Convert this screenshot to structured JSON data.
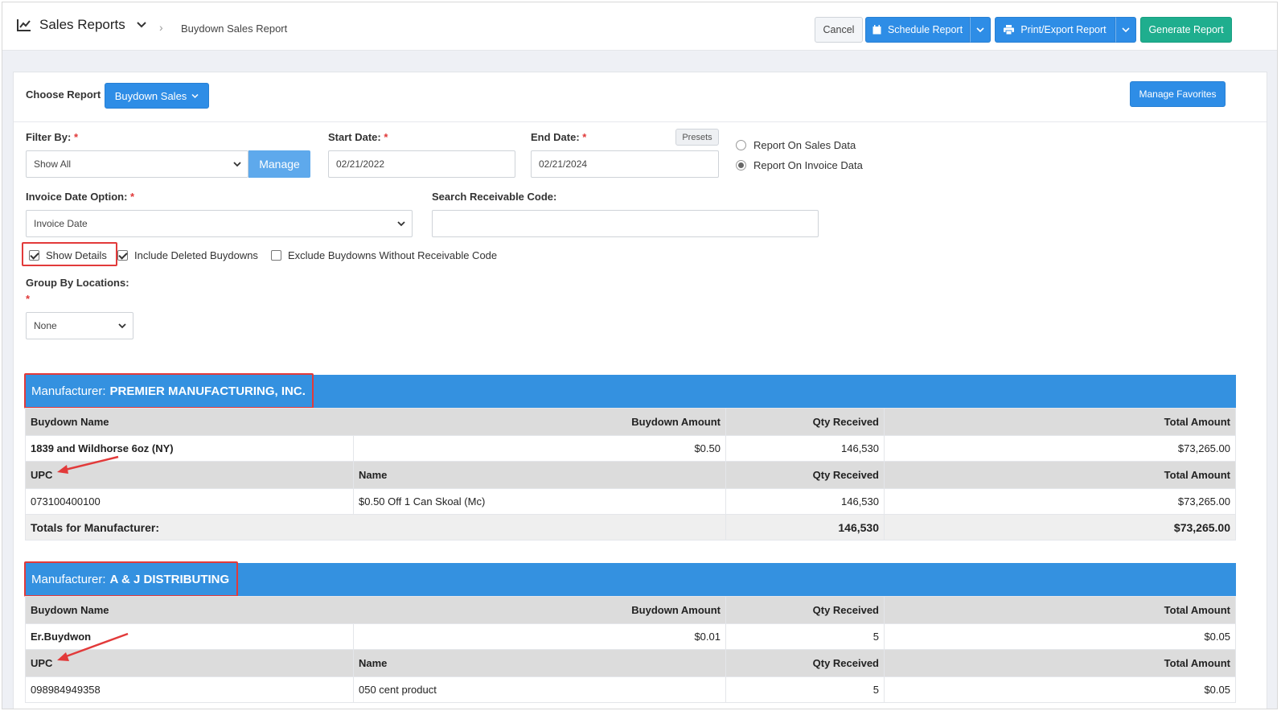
{
  "header": {
    "title": "Sales Reports",
    "breadcrumb": "Buydown Sales Report",
    "cancel": "Cancel",
    "schedule": "Schedule Report",
    "print": "Print/Export Report",
    "generate": "Generate Report"
  },
  "choose": {
    "label": "Choose Report",
    "report": "Buydown Sales",
    "manage_favorites": "Manage Favorites"
  },
  "filters": {
    "filter_by_label": "Filter By:",
    "filter_by_value": "Show All",
    "manage": "Manage",
    "start_label": "Start Date:",
    "start_value": "02/21/2022",
    "end_label": "End Date:",
    "end_value": "02/21/2024",
    "presets": "Presets",
    "radio_sales": "Report On Sales Data",
    "radio_invoice": "Report On Invoice Data",
    "invoice_date_label": "Invoice Date Option:",
    "invoice_date_value": "Invoice Date",
    "search_code_label": "Search Receivable Code:",
    "search_code_value": "",
    "show_details": "Show Details",
    "include_deleted": "Include Deleted Buydowns",
    "exclude_without_code": "Exclude Buydowns Without Receivable Code",
    "group_by_label": "Group By Locations:",
    "group_by_value": "None",
    "required_mark": "*"
  },
  "manufacturers": [
    {
      "prefix": "Manufacturer:",
      "name": "PREMIER MANUFACTURING, INC.",
      "cols": {
        "buydown_name": "Buydown Name",
        "buydown_amount": "Buydown Amount",
        "qty": "Qty Received",
        "total": "Total Amount"
      },
      "row": {
        "name": "1839 and Wildhorse 6oz (NY)",
        "amount": "$0.50",
        "qty": "146,530",
        "total": "$73,265.00"
      },
      "detail_cols": {
        "upc": "UPC",
        "name": "Name",
        "qty": "Qty Received",
        "total": "Total Amount"
      },
      "detail": {
        "upc": "073100400100",
        "name": "$0.50 Off 1 Can Skoal (Mc)",
        "qty": "146,530",
        "total": "$73,265.00"
      },
      "totals": {
        "label": "Totals for Manufacturer:",
        "qty": "146,530",
        "total": "$73,265.00"
      }
    },
    {
      "prefix": "Manufacturer:",
      "name": "A & J DISTRIBUTING",
      "cols": {
        "buydown_name": "Buydown Name",
        "buydown_amount": "Buydown Amount",
        "qty": "Qty Received",
        "total": "Total Amount"
      },
      "row": {
        "name": "Er.Buydwon",
        "amount": "$0.01",
        "qty": "5",
        "total": "$0.05"
      },
      "detail_cols": {
        "upc": "UPC",
        "name": "Name",
        "qty": "Qty Received",
        "total": "Total Amount"
      },
      "detail": {
        "upc": "098984949358",
        "name": "050 cent product",
        "qty": "5",
        "total": "$0.05"
      }
    }
  ],
  "colors": {
    "accent": "#3491e0",
    "green": "#1fae8e",
    "highlight": "#e23a3a"
  }
}
